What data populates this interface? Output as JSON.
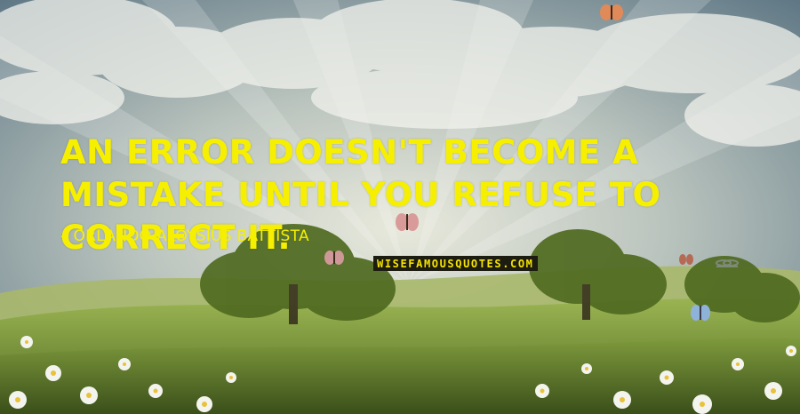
{
  "quote": {
    "text": "AN ERROR DOESN'T BECOME A MISTAKE UNTIL YOU REFUSE TO CORRECT IT.",
    "author_prefix": "-",
    "author": "ORLANDO ALOYSIUS BATTISTA"
  },
  "brand": {
    "text": "WISEFAMOUSQUOTES.COM"
  },
  "colors": {
    "quote_text": "#f6f000",
    "brand_bg": "#1c1c10",
    "brand_text": "#f6e400"
  }
}
